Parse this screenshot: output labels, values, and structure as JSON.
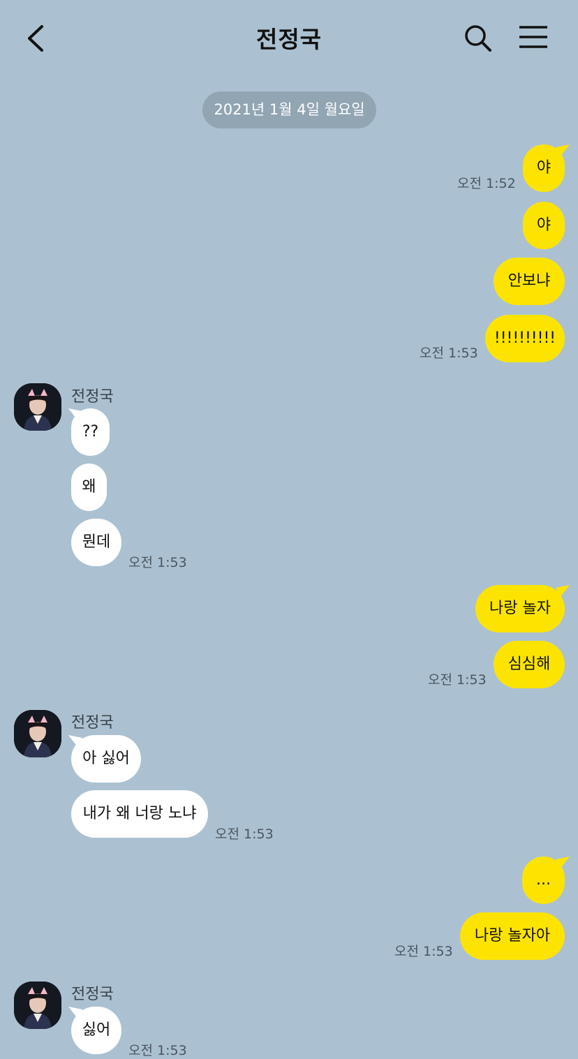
{
  "header": {
    "title": "전정국"
  },
  "date_divider": "2021년 1월 4일 월요일",
  "colors": {
    "background": "#abc1d1",
    "my_bubble": "#fde400",
    "their_bubble": "#ffffff",
    "date_pill": "#91a5b3"
  },
  "icons": {
    "back": "chevron-left-icon",
    "search": "search-icon",
    "menu": "hamburger-menu-icon"
  },
  "messages": {
    "m1": {
      "text": "야",
      "time": "오전 1:52"
    },
    "m2": {
      "text": "야"
    },
    "m3": {
      "text": "안보냐"
    },
    "m4": {
      "text": "!!!!!!!!!!",
      "time": "오전 1:53"
    },
    "g1": {
      "sender": "전정국",
      "m1": {
        "text": "??"
      },
      "m2": {
        "text": "왜"
      },
      "m3": {
        "text": "뭔데",
        "time": "오전 1:53"
      }
    },
    "m5": {
      "text": "나랑 놀자"
    },
    "m6": {
      "text": "심심해",
      "time": "오전 1:53"
    },
    "g2": {
      "sender": "전정국",
      "m1": {
        "text": "아 싫어"
      },
      "m2": {
        "text": "내가 왜 너랑 노냐",
        "time": "오전 1:53"
      }
    },
    "m7": {
      "text": "..."
    },
    "m8": {
      "text": "나랑 놀자아",
      "time": "오전 1:53"
    },
    "g3": {
      "sender": "전정국",
      "m1": {
        "text": "싫어",
        "time": "오전 1:53"
      }
    }
  }
}
